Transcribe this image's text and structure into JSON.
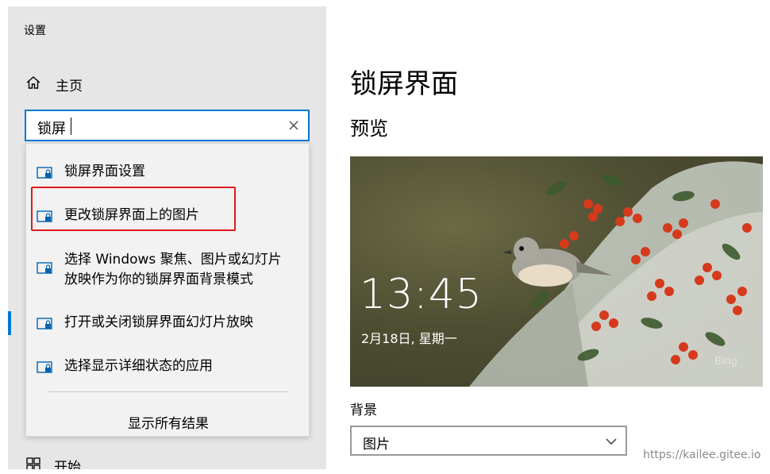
{
  "window": {
    "title": "设置"
  },
  "nav": {
    "home_label": "主页",
    "bottom_item_label": "开始"
  },
  "search": {
    "value": "锁屏",
    "results": [
      {
        "label": "锁屏界面设置",
        "icon": "lock-screen-icon"
      },
      {
        "label": "更改锁屏界面上的图片",
        "icon": "lock-screen-icon",
        "highlighted": true
      },
      {
        "label_line1": "选择 Windows 聚焦、图片或幻灯片",
        "label_line2": "放映作为你的锁屏界面背景模式",
        "icon": "lock-screen-icon"
      },
      {
        "label": "打开或关闭锁屏界面幻灯片放映",
        "icon": "lock-screen-icon"
      },
      {
        "label": "选择显示详细状态的应用",
        "icon": "lock-screen-icon"
      }
    ],
    "show_all_label": "显示所有结果"
  },
  "main": {
    "page_title": "锁屏界面",
    "preview_heading": "预览",
    "preview": {
      "time": "13:45",
      "date": "2月18日, 星期一",
      "watermark": "Bing"
    },
    "background_label": "背景",
    "background_value": "图片"
  },
  "site_watermark": "https://kailee.gitee.io",
  "colors": {
    "accent": "#0078d7",
    "highlight_border": "#e0191c",
    "sidebar_bg": "#e6e6e6",
    "dropdown_bg": "#f2f2f2"
  }
}
